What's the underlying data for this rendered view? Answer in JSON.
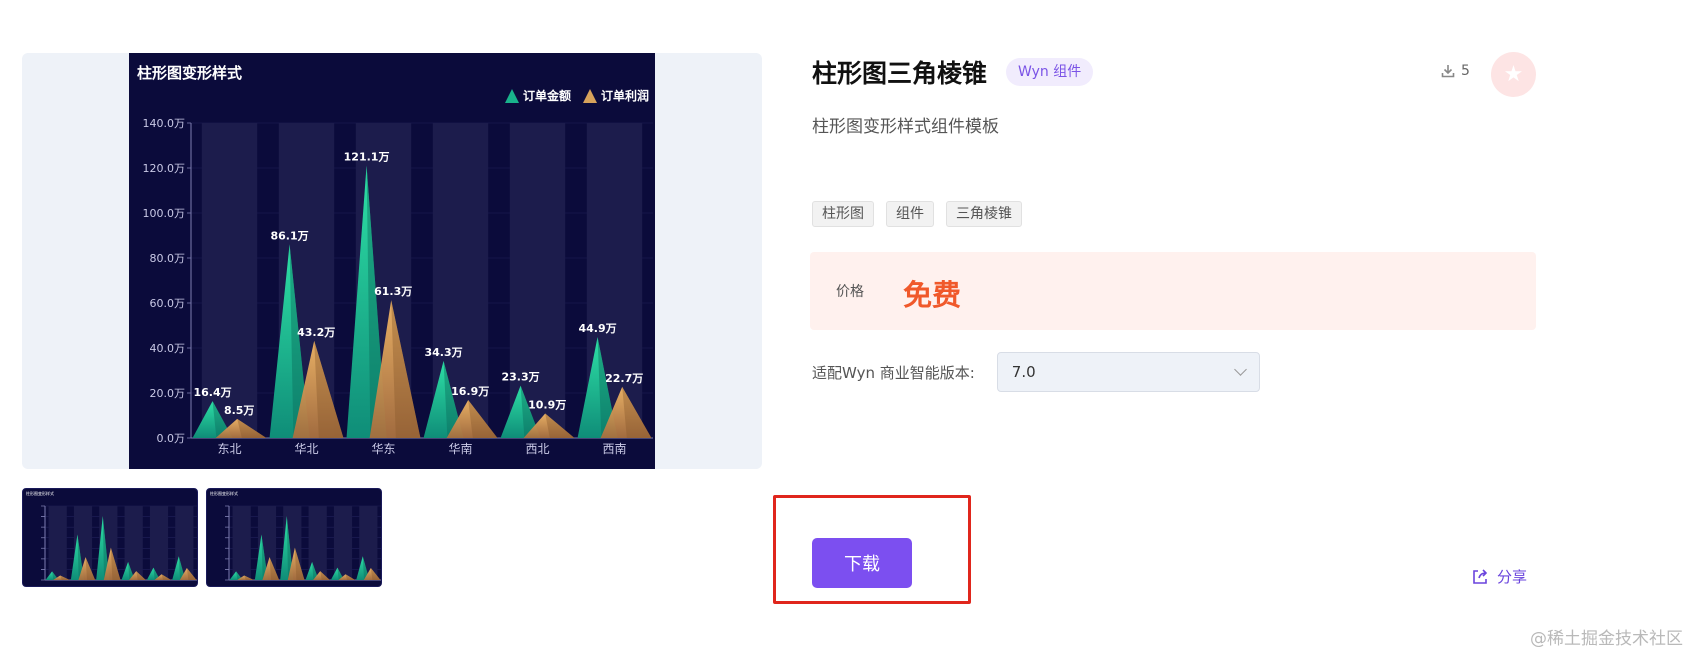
{
  "product": {
    "title": "柱形图三角棱锥",
    "type_badge": "Wyn 组件",
    "downloads": "5",
    "subtitle": "柱形图变形样式组件模板",
    "tags": [
      "柱形图",
      "组件",
      "三角棱锥"
    ],
    "price_label": "价格",
    "price_value": "免费",
    "version_label": "适配Wyn 商业智能版本:",
    "version_value": "7.0",
    "download_label": "下载",
    "share_label": "分享"
  },
  "icons": {
    "download_count": "download-icon",
    "favorite": "star-icon",
    "share": "share-icon",
    "select": "chevron-down-icon"
  },
  "colors": {
    "accent": "#7c4ff0",
    "price": "#f0592b",
    "highlight": "#e0261c",
    "chart_bg": "#0b0b3b",
    "series_amount": "#19b38c",
    "series_profit": "#d6a25b"
  },
  "watermark": "@稀土掘金技术社区",
  "chart_data": {
    "type": "bar",
    "title": "柱形图变形样式",
    "categories": [
      "东北",
      "华北",
      "华东",
      "华南",
      "西北",
      "西南"
    ],
    "series": [
      {
        "name": "订单金额",
        "values": [
          16.4,
          86.1,
          121.1,
          34.3,
          23.3,
          44.9
        ],
        "labels": [
          "16.4万",
          "86.1万",
          "121.1万",
          "34.3万",
          "23.3万",
          "44.9万"
        ]
      },
      {
        "name": "订单利润",
        "values": [
          8.5,
          43.2,
          61.3,
          16.9,
          10.9,
          22.7
        ],
        "labels": [
          "8.5万",
          "43.2万",
          "61.3万",
          "16.9万",
          "10.9万",
          "22.7万"
        ]
      }
    ],
    "ylim": [
      0,
      140
    ],
    "yticks": [
      "0.0万",
      "20.0万",
      "40.0万",
      "60.0万",
      "80.0万",
      "100.0万",
      "120.0万",
      "140.0万"
    ],
    "legend": "top-right",
    "grid": false
  }
}
